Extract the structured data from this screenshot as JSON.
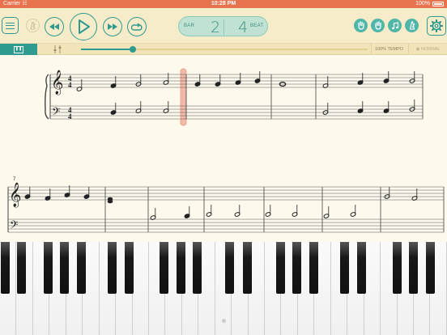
{
  "status_bar": {
    "carrier": "Carrier",
    "time": "10:28 PM",
    "battery": "100%"
  },
  "toolbar": {
    "counter": {
      "bar_label": "BAR",
      "bar_value": "2",
      "beat_label": "BEAT",
      "beat_value": "4"
    }
  },
  "subbar": {
    "tempo_label": "100% TEMPO",
    "normal_label": "NORMAL",
    "tempo_slider_value": 0.18
  },
  "score": {
    "second_system_measure_number": "7"
  },
  "icons": {
    "menu": "hamburger-icon",
    "metronome_mute": "metronome-icon",
    "rewind": "rewind-icon",
    "play": "play-icon",
    "fast_forward": "fast-forward-icon",
    "loop": "loop-icon",
    "left_hand": "left-hand-icon",
    "right_hand": "right-hand-icon",
    "note_names": "music-note-icon",
    "metronome": "metronome-icon",
    "settings": "gear-icon",
    "keyboard_tab": "piano-keys-icon",
    "mixer_tab": "mixer-sliders-icon"
  },
  "colors": {
    "accent": "#2f9a8f",
    "status_bar": "#e8734f",
    "toolbar_bg": "#f6ecc9",
    "cursor": "#f3b9a8"
  }
}
